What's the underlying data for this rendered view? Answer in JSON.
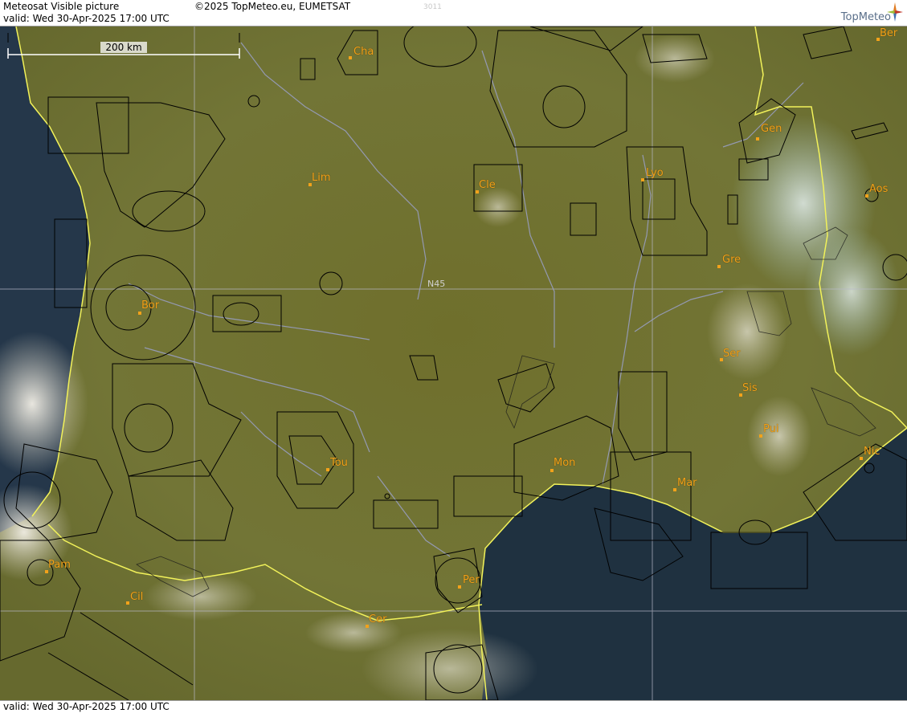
{
  "header": {
    "title": "Meteosat Visible picture",
    "copyright": "©2025 TopMeteo.eu, EUMETSAT",
    "code": "3011",
    "valid": "valid:  Wed  30-Apr-2025  17:00 UTC",
    "logo_text": "TopMeteo"
  },
  "footer": {
    "valid": "valid:  Wed  30-Apr-2025  17:00 UTC"
  },
  "map": {
    "scale_label": "200 km",
    "lat_label": "N45",
    "cities": [
      "Cha",
      "Ber",
      "Gen",
      "Lim",
      "Cle",
      "Lyo",
      "Aos",
      "Gre",
      "Bor",
      "Ser",
      "Sis",
      "Pui",
      "Tou",
      "Mon",
      "Mar",
      "Nic",
      "Pam",
      "Per",
      "Cil",
      "Cer"
    ]
  },
  "colors": {
    "land": "#6e7130",
    "sea": "#1e2f3a",
    "coast": "#f2f25a",
    "rivers": "#9aa0c8",
    "label": "#f2a21a"
  }
}
